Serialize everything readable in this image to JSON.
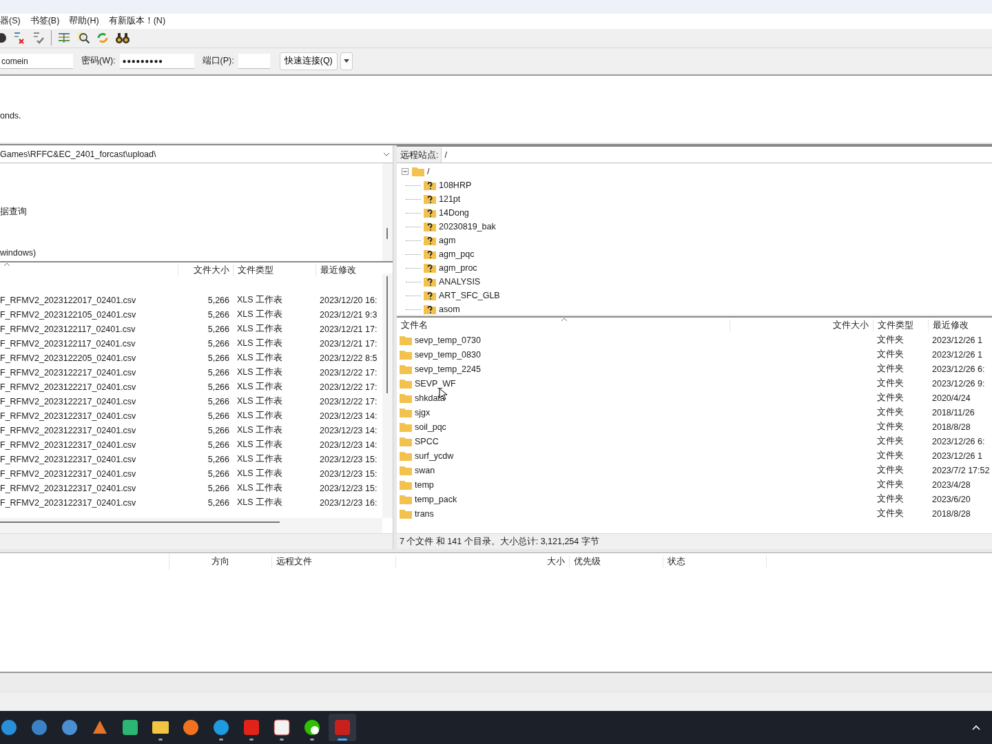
{
  "menu": [
    "器(S)",
    "书签(B)",
    "帮助(H)",
    "有新版本！(N)"
  ],
  "quickconnect": {
    "user": "comein",
    "password_label": "密码(W):",
    "password": "●●●●●●●●●",
    "port_label": "端口(P):",
    "button": "快速连接(Q)"
  },
  "message_log": [
    "onds."
  ],
  "local": {
    "path": "Games\\RFFC&EC_2401_forcast\\upload\\",
    "tree": [
      "据查询",
      "windows)"
    ],
    "columns": [
      "文件大小",
      "文件类型",
      "最近修改"
    ],
    "rows": [
      {
        "name": "F_RFMV2_2023122017_02401.csv",
        "size": "5,266",
        "type": "XLS 工作表",
        "modified": "2023/12/20 16:"
      },
      {
        "name": "F_RFMV2_2023122105_02401.csv",
        "size": "5,266",
        "type": "XLS 工作表",
        "modified": "2023/12/21 9:3"
      },
      {
        "name": "F_RFMV2_2023122117_02401.csv",
        "size": "5,266",
        "type": "XLS 工作表",
        "modified": "2023/12/21 17:"
      },
      {
        "name": "F_RFMV2_2023122117_02401.csv",
        "size": "5,266",
        "type": "XLS 工作表",
        "modified": "2023/12/21 17:"
      },
      {
        "name": "F_RFMV2_2023122205_02401.csv",
        "size": "5,266",
        "type": "XLS 工作表",
        "modified": "2023/12/22 8:5"
      },
      {
        "name": "F_RFMV2_2023122217_02401.csv",
        "size": "5,266",
        "type": "XLS 工作表",
        "modified": "2023/12/22 17:"
      },
      {
        "name": "F_RFMV2_2023122217_02401.csv",
        "size": "5,266",
        "type": "XLS 工作表",
        "modified": "2023/12/22 17:"
      },
      {
        "name": "F_RFMV2_2023122217_02401.csv",
        "size": "5,266",
        "type": "XLS 工作表",
        "modified": "2023/12/22 17:"
      },
      {
        "name": "F_RFMV2_2023122317_02401.csv",
        "size": "5,266",
        "type": "XLS 工作表",
        "modified": "2023/12/23 14:"
      },
      {
        "name": "F_RFMV2_2023122317_02401.csv",
        "size": "5,266",
        "type": "XLS 工作表",
        "modified": "2023/12/23 14:"
      },
      {
        "name": "F_RFMV2_2023122317_02401.csv",
        "size": "5,266",
        "type": "XLS 工作表",
        "modified": "2023/12/23 14:"
      },
      {
        "name": "F_RFMV2_2023122317_02401.csv",
        "size": "5,266",
        "type": "XLS 工作表",
        "modified": "2023/12/23 15:"
      },
      {
        "name": "F_RFMV2_2023122317_02401.csv",
        "size": "5,266",
        "type": "XLS 工作表",
        "modified": "2023/12/23 15:"
      },
      {
        "name": "F_RFMV2_2023122317_02401.csv",
        "size": "5,266",
        "type": "XLS 工作表",
        "modified": "2023/12/23 15:"
      },
      {
        "name": "F_RFMV2_2023122317_02401.csv",
        "size": "5,266",
        "type": "XLS 工作表",
        "modified": "2023/12/23 16:"
      }
    ]
  },
  "remote": {
    "site_label": "远程站点:",
    "path": "/",
    "tree": {
      "label": "/",
      "expanded": true,
      "children": [
        "108HRP",
        "121pt",
        "14Dong",
        "20230819_bak",
        "agm",
        "agm_pqc",
        "agm_proc",
        "ANALYSIS",
        "ART_SFC_GLB",
        "asom"
      ]
    },
    "columns": [
      "文件名",
      "文件大小",
      "文件类型",
      "最近修改"
    ],
    "rows": [
      {
        "name": "sevp_temp_0730",
        "type": "文件夹",
        "modified": "2023/12/26 1"
      },
      {
        "name": "sevp_temp_0830",
        "type": "文件夹",
        "modified": "2023/12/26 1"
      },
      {
        "name": "sevp_temp_2245",
        "type": "文件夹",
        "modified": "2023/12/26 6:"
      },
      {
        "name": "SEVP_WF",
        "type": "文件夹",
        "modified": "2023/12/26 9:"
      },
      {
        "name": "shkdata",
        "type": "文件夹",
        "modified": "2020/4/24"
      },
      {
        "name": "sjgx",
        "type": "文件夹",
        "modified": "2018/11/26"
      },
      {
        "name": "soil_pqc",
        "type": "文件夹",
        "modified": "2018/8/28"
      },
      {
        "name": "SPCC",
        "type": "文件夹",
        "modified": "2023/12/26 6:"
      },
      {
        "name": "surf_ycdw",
        "type": "文件夹",
        "modified": "2023/12/26 1"
      },
      {
        "name": "swan",
        "type": "文件夹",
        "modified": "2023/7/2 17:52"
      },
      {
        "name": "temp",
        "type": "文件夹",
        "modified": "2023/4/28"
      },
      {
        "name": "temp_pack",
        "type": "文件夹",
        "modified": "2023/6/20"
      },
      {
        "name": "trans",
        "type": "文件夹",
        "modified": "2018/8/28"
      }
    ],
    "status": "7 个文件 和 141 个目录。大小总计: 3,121,254 字节"
  },
  "queue": {
    "columns": [
      "方向",
      "远程文件",
      "大小",
      "优先级",
      "状态"
    ]
  },
  "taskbar": [
    {
      "running": false,
      "selected": false
    },
    {
      "running": false,
      "selected": false
    },
    {
      "running": false,
      "selected": false
    },
    {
      "running": false,
      "selected": false
    },
    {
      "running": false,
      "selected": false
    },
    {
      "running": true,
      "selected": false
    },
    {
      "running": false,
      "selected": false
    },
    {
      "running": true,
      "selected": false
    },
    {
      "running": true,
      "selected": false
    },
    {
      "running": true,
      "selected": false
    },
    {
      "running": true,
      "selected": false
    },
    {
      "running": true,
      "selected": true
    }
  ]
}
